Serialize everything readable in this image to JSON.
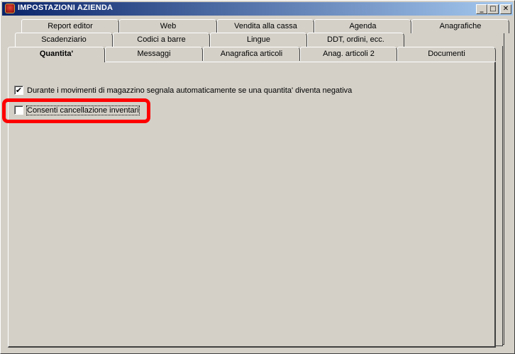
{
  "window": {
    "title": "IMPOSTAZIONI AZIENDA",
    "controls": {
      "minimize": "_",
      "maximize": "□",
      "close": "✕"
    }
  },
  "tabs": {
    "row1": [
      "Report editor",
      "Web",
      "Vendita alla cassa",
      "Agenda",
      "Anagrafiche"
    ],
    "row2": [
      "Scadenziario",
      "Codici a barre",
      "Lingue",
      "DDT, ordini, ecc."
    ],
    "row3": [
      "Quantita'",
      "Messaggi",
      "Anagrafica articoli",
      "Anag. articoli 2",
      "Documenti"
    ],
    "selected": "Quantita'"
  },
  "options": [
    {
      "label": "Durante i movimenti di magazzino segnala automaticamente se una quantita' diventa negativa",
      "checked": true,
      "mark": "✔"
    },
    {
      "label": "Consenti cancellazione inventari",
      "checked": false,
      "mark": ""
    }
  ],
  "annotation": {
    "highlight_color": "#ff0000"
  }
}
